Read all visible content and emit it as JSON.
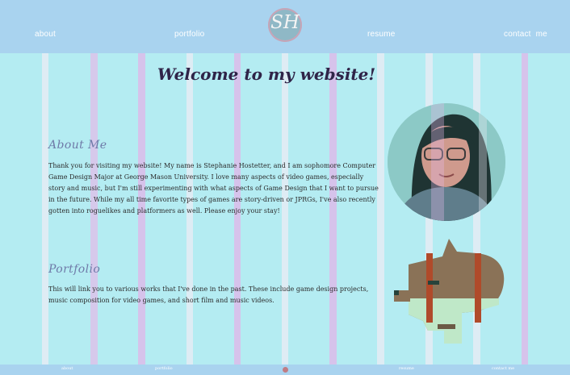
{
  "nav": {
    "logo_text": "SH",
    "links": [
      "about",
      "portfolio",
      "resume",
      "contact  me"
    ]
  },
  "hero": {
    "title": "Welcome to my website!"
  },
  "about": {
    "heading": "About Me",
    "body": "Thank you for visiting my website! My name is Stephanie Hostetter, and I am sophomore Computer Game Design Major at George Mason University. I love many aspects of video games, especially story and music, but I'm still experimenting with what aspects of Game Design that I want to pursue in the future. While my all time favorite types of games are story-driven or JPRGs, I've also recently gotten into roguelikes and platformers as well. Please enjoy your stay!"
  },
  "portfolio": {
    "heading": "Portfolio",
    "body": "This will link you to various works that I've done in the past. These include game design projects, music composition for video games, and short film and music videos."
  },
  "footer": {
    "links": [
      "about",
      "portfolio",
      "resume",
      "contact me"
    ]
  },
  "colors": {
    "background": "#b4ecf2",
    "nav_background": "#a9d3ef",
    "title": "#2f2448",
    "heading": "#6f7aa8",
    "stripe_pink": "#e2b6e8",
    "stripe_white": "#e9eef4"
  },
  "icons": {
    "logo": "sh-monogram",
    "portfolio_art": "pixel-shiba-dog"
  }
}
